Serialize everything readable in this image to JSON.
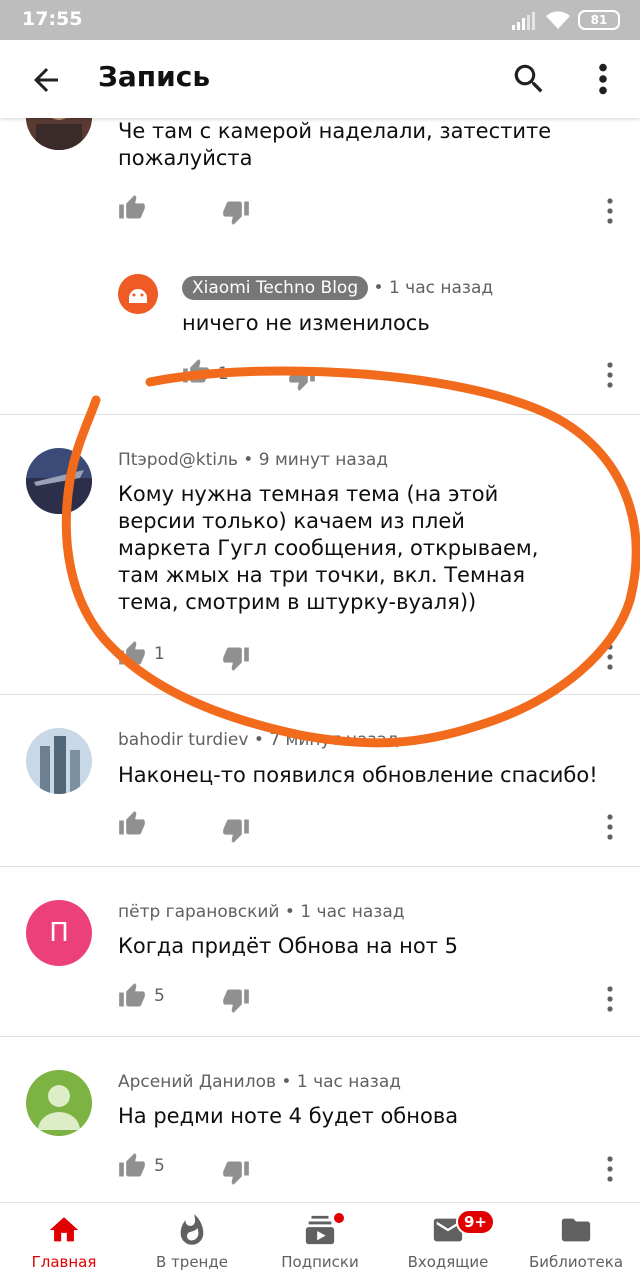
{
  "status_bar": {
    "time": "17:55",
    "battery": "81"
  },
  "app_bar": {
    "title": "Запись"
  },
  "comments": [
    {
      "text": "Че там с камерой наделали, затестите пожалуйста"
    },
    {
      "author": "Xiaomi Techno Blog",
      "time": "1 час назад",
      "text": "ничего не изменилось",
      "likes": "1"
    },
    {
      "author": "Пtэpod@ktіль",
      "time": "9 минут назад",
      "text": "Кому нужна темная тема (на этой версии только) качаем из плей маркета Гугл сообщения, открываем, там жмых на три точки, вкл. Темная тема, смотрим в штурку-вуаля))",
      "likes": "1"
    },
    {
      "author": "bahodir turdiev",
      "time": "7 минут назад",
      "text": "Наконец-то появился обновление спасибо!"
    },
    {
      "author": "пётр гарановский",
      "time": "1 час назад",
      "text": "Когда придёт Обнова на нот 5",
      "likes": "5",
      "avatar_letter": "П"
    },
    {
      "author": "Арсений Данилов",
      "time": "1 час назад",
      "text": "На редми ноте 4 будет обнова",
      "likes": "5"
    }
  ],
  "bottom_nav": {
    "items": [
      {
        "label": "Главная"
      },
      {
        "label": "В тренде"
      },
      {
        "label": "Подписки"
      },
      {
        "label": "Входящие",
        "badge": "9+"
      },
      {
        "label": "Библиотека"
      }
    ]
  },
  "colors": {
    "accent": "#e00000",
    "annotation": "#f26b1d",
    "status_bar": "#bdbdbd"
  }
}
